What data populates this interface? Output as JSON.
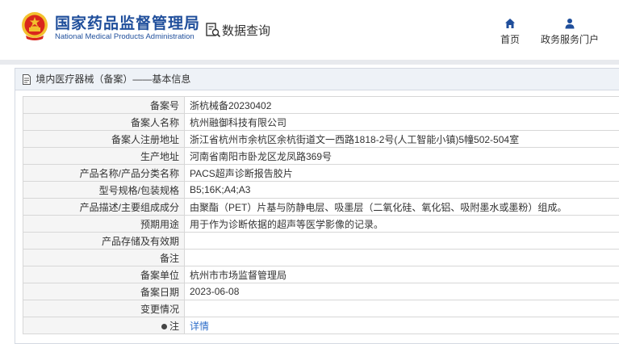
{
  "header": {
    "logo_cn": "国家药品监督管理局",
    "logo_en": "National Medical Products Administration",
    "query_title": "数据查询",
    "nav": {
      "home": "首页",
      "gov_service": "政务服务门户"
    },
    "colors": {
      "brand": "#1f4e9b",
      "emblem_red": "#d9261c",
      "emblem_gold": "#f2c12e"
    },
    "icons": [
      "national-emblem",
      "magnifier-document-icon",
      "home-icon",
      "user-icon"
    ]
  },
  "panel": {
    "title": "境内医疗器械（备案）——基本信息",
    "icon": "document-icon"
  },
  "rows": [
    {
      "label": "备案号",
      "value": "浙杭械备20230402"
    },
    {
      "label": "备案人名称",
      "value": "杭州融御科技有限公司"
    },
    {
      "label": "备案人注册地址",
      "value": "浙江省杭州市余杭区余杭街道文一西路1818-2号(人工智能小镇)5幢502-504室"
    },
    {
      "label": "生产地址",
      "value": "河南省南阳市卧龙区龙凤路369号"
    },
    {
      "label": "产品名称/产品分类名称",
      "value": "PACS超声诊断报告胶片"
    },
    {
      "label": "型号规格/包装规格",
      "value": "B5;16K;A4;A3"
    },
    {
      "label": "产品描述/主要组成成分",
      "value": "由聚酯（PET）片基与防静电层、吸墨层（二氧化硅、氧化铝、吸附墨水或墨粉）组成。"
    },
    {
      "label": "预期用途",
      "value": "用于作为诊断依据的超声等医学影像的记录。"
    },
    {
      "label": "产品存储及有效期",
      "value": ""
    },
    {
      "label": "备注",
      "value": ""
    },
    {
      "label": "备案单位",
      "value": "杭州市市场监督管理局"
    },
    {
      "label": "备案日期",
      "value": "2023-06-08"
    },
    {
      "label": "变更情况",
      "value": ""
    }
  ],
  "note_row": {
    "label": "注",
    "link": "详情"
  }
}
